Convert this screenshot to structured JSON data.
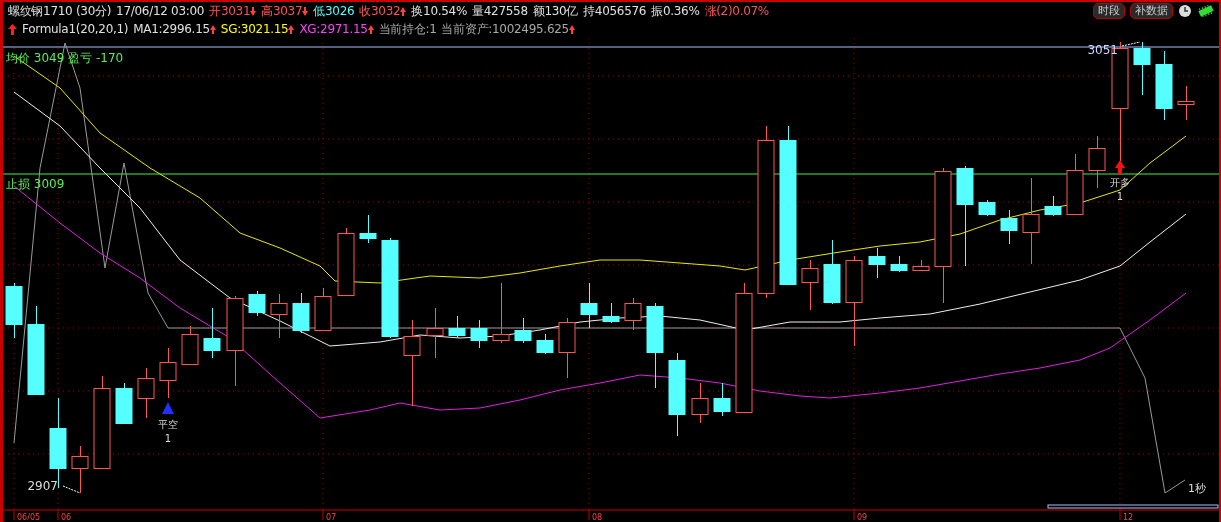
{
  "quote_bar": [
    {
      "text": "螺纹钢1710 (30分)",
      "color": "#e0e0e0",
      "kind": "plain"
    },
    {
      "text": "17/06/12 03:00",
      "color": "#e0e0e0",
      "kind": "plain"
    },
    {
      "text": "开3031",
      "color": "#ff5555",
      "kind": "falling"
    },
    {
      "text": "高3037",
      "color": "#ff5555",
      "kind": "falling"
    },
    {
      "text": "低3026",
      "color": "#55ffff",
      "kind": "plain"
    },
    {
      "text": "收3032",
      "color": "#ff5555",
      "kind": "rising"
    },
    {
      "text": "换10.54%",
      "color": "#e0e0e0",
      "kind": "plain"
    },
    {
      "text": "量427558",
      "color": "#e0e0e0",
      "kind": "plain"
    },
    {
      "text": "额130亿",
      "color": "#e0e0e0",
      "kind": "plain"
    },
    {
      "text": "持4056576",
      "color": "#e0e0e0",
      "kind": "plain"
    },
    {
      "text": "振0.36%",
      "color": "#e0e0e0",
      "kind": "plain"
    },
    {
      "text": "涨(2)0.07%",
      "color": "#ff5555",
      "kind": "plain"
    }
  ],
  "indicator_bar": [
    {
      "text": "Formula1(20,20,1)",
      "color": "#e0e0e0",
      "kind": "plain"
    },
    {
      "text": "MA1:2996.15",
      "color": "#e0e0e0",
      "kind": "rising"
    },
    {
      "text": "SG:3021.15",
      "color": "#ffff00",
      "kind": "rising"
    },
    {
      "text": "XG:2971.15",
      "color": "#ff40ff",
      "kind": "rising"
    },
    {
      "text": "当前持仓:1",
      "color": "#a8a8a8",
      "kind": "plain"
    },
    {
      "text": "当前资产:1002495.625",
      "color": "#a8a8a8",
      "kind": "rising"
    }
  ],
  "toolbar_buttons": [
    "时段",
    "补数据"
  ],
  "chart": {
    "avg_line_label": "均价 3049 盈亏 -170",
    "stop_line_label": "止损 3009",
    "high_label": "3051",
    "low_label": "2907",
    "signals": [
      {
        "kind": "close_short",
        "label": "平空",
        "count": "1"
      },
      {
        "kind": "open_long",
        "label": "开多",
        "count": "1"
      }
    ],
    "timer_label": "1秒",
    "x_labels": [
      "06/05",
      "06",
      "07",
      "08",
      "09",
      "12"
    ]
  }
}
